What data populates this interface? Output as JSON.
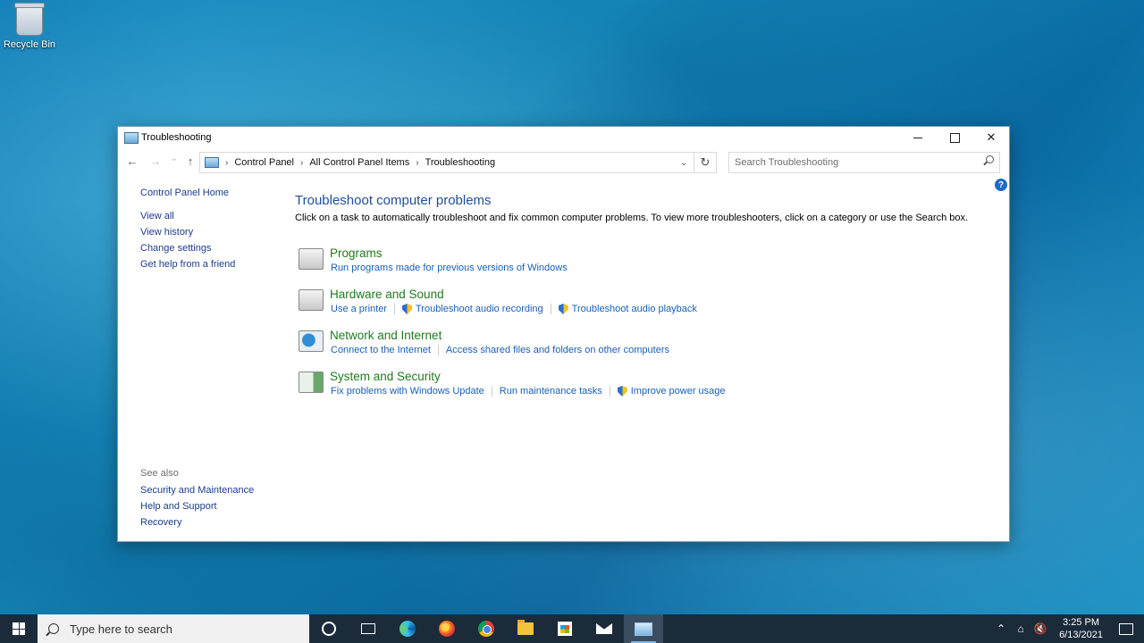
{
  "desktop": {
    "recycle_bin_label": "Recycle Bin"
  },
  "window": {
    "title": "Troubleshooting",
    "controls": {
      "minimize": "—",
      "close": "✕"
    }
  },
  "nav": {
    "back": "←",
    "forward": "→",
    "recent": "⌄",
    "up": "↑",
    "breadcrumb": [
      "Control Panel",
      "All Control Panel Items",
      "Troubleshooting"
    ],
    "refresh": "↻",
    "dropdown": "⌄",
    "search_placeholder": "Search Troubleshooting"
  },
  "help_label": "?",
  "sidebar": {
    "home": "Control Panel Home",
    "tasks": [
      "View all",
      "View history",
      "Change settings",
      "Get help from a friend"
    ],
    "see_also_heading": "See also",
    "see_also": [
      "Security and Maintenance",
      "Help and Support",
      "Recovery"
    ]
  },
  "main": {
    "heading": "Troubleshoot computer problems",
    "description": "Click on a task to automatically troubleshoot and fix common computer problems. To view more troubleshooters, click on a category or use the Search box.",
    "categories": [
      {
        "title": "Programs",
        "icon": "programs-icon",
        "links": [
          {
            "label": "Run programs made for previous versions of Windows",
            "shield": false
          }
        ]
      },
      {
        "title": "Hardware and Sound",
        "icon": "printer-icon",
        "links": [
          {
            "label": "Use a printer",
            "shield": false
          },
          {
            "label": "Troubleshoot audio recording",
            "shield": true
          },
          {
            "label": "Troubleshoot audio playback",
            "shield": true
          }
        ]
      },
      {
        "title": "Network and Internet",
        "icon": "network-icon",
        "links": [
          {
            "label": "Connect to the Internet",
            "shield": false
          },
          {
            "label": "Access shared files and folders on other computers",
            "shield": false
          }
        ]
      },
      {
        "title": "System and Security",
        "icon": "system-icon",
        "links": [
          {
            "label": "Fix problems with Windows Update",
            "shield": false
          },
          {
            "label": "Run maintenance tasks",
            "shield": false
          },
          {
            "label": "Improve power usage",
            "shield": true
          }
        ]
      }
    ]
  },
  "taskbar": {
    "search_placeholder": "Type here to search",
    "apps": [
      "cortana-icon",
      "task-view-icon",
      "edge-icon",
      "firefox-icon",
      "chrome-icon",
      "file-explorer-icon",
      "store-icon",
      "mail-icon",
      "control-panel-icon"
    ],
    "tray": {
      "chevron": "⌃",
      "network": "⌂",
      "volume": "🔇",
      "time": "3:25 PM",
      "date": "6/13/2021"
    }
  }
}
